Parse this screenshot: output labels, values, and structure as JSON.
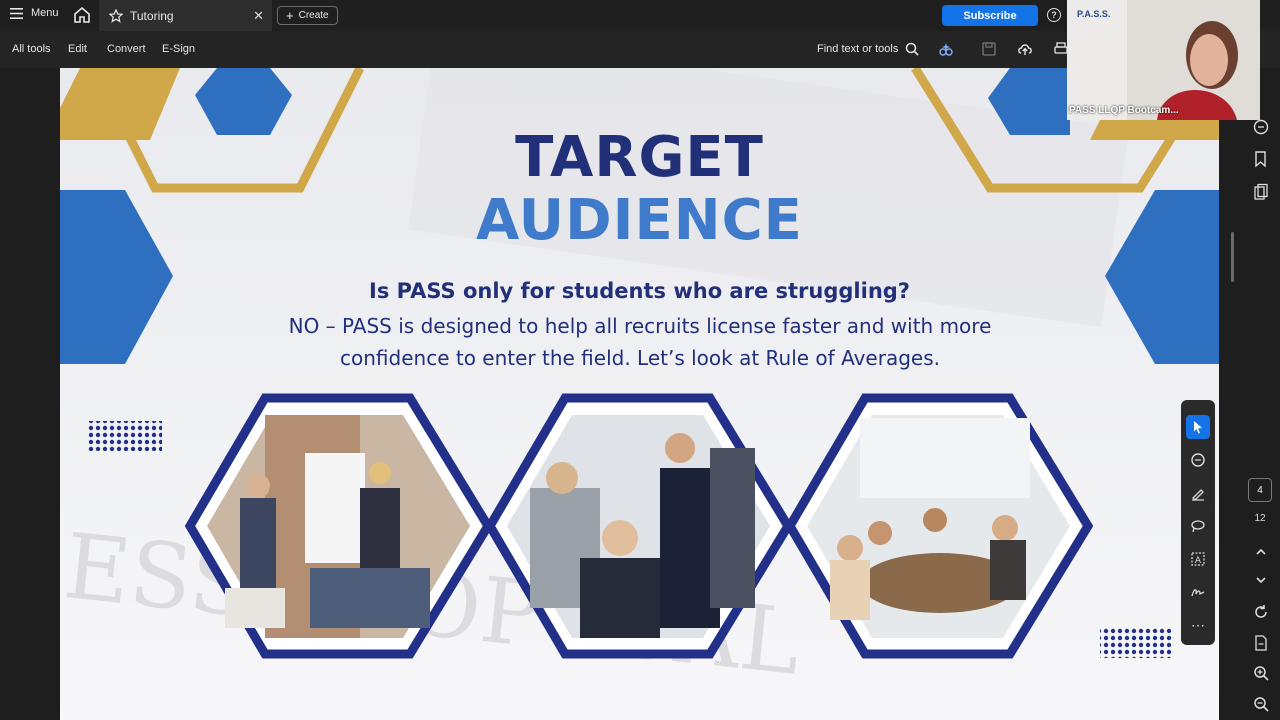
{
  "topbar": {
    "menu_label": "Menu",
    "tab_title": "Tutoring",
    "create_label": "Create",
    "subscribe_label": "Subscribe",
    "help_symbol": "?"
  },
  "toolbar": {
    "items": [
      "All tools",
      "Edit",
      "Convert",
      "E-Sign"
    ],
    "find_label": "Find text or tools"
  },
  "slide": {
    "title_line1": "TARGET",
    "title_line2": "AUDIENCE",
    "question": "Is PASS only for students who are struggling?",
    "answer_line1": "NO – PASS is designed to help all recruits license faster and with more",
    "answer_line2": "confidence to enter the field.  Let’s look at Rule of Averages.",
    "colors": {
      "navy": "#22307a",
      "blue": "#3f7acb",
      "hex_blue": "#2e6fbf",
      "gold": "#d0a84a",
      "frame": "#22308a"
    },
    "photos": [
      "team-whiteboard-meeting-photo",
      "colleagues-laptop-photo",
      "group-table-discussion-photo"
    ]
  },
  "webcam": {
    "label": "PASS LLQP Bootcam...",
    "logo_text": "P.A.S.S."
  },
  "page_nav": {
    "current_page": "4",
    "total_pages": "12"
  },
  "icons": {
    "menu": "hamburger-icon",
    "home": "home-icon",
    "favorite": "star-icon",
    "close": "close-icon",
    "search": "search-icon",
    "select": "cursor-arrow-icon",
    "comment": "comment-icon",
    "highlight": "pen-icon",
    "draw": "lasso-icon",
    "text": "text-box-icon",
    "sign": "signature-icon",
    "more": "more-icon"
  }
}
